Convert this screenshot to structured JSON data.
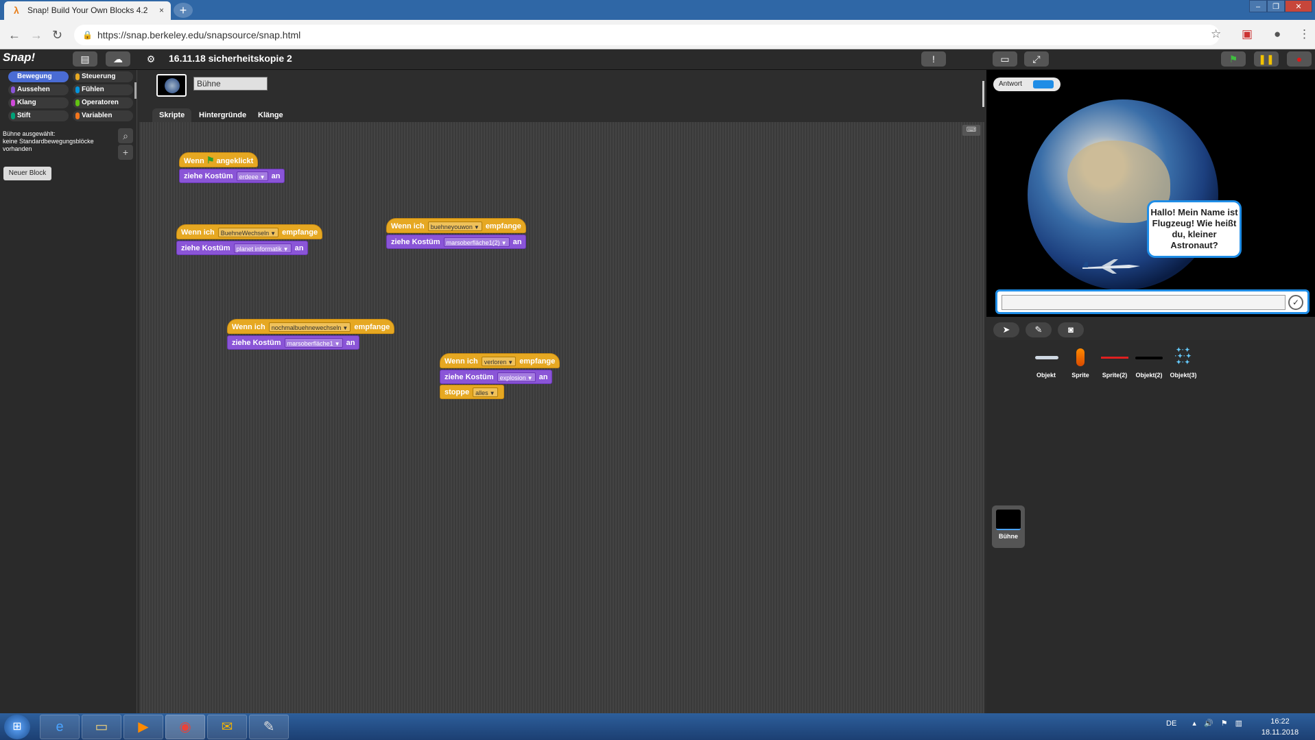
{
  "browser": {
    "tab_title": "Snap! Build Your Own Blocks 4.2",
    "tab_close": "×",
    "new_tab": "+",
    "url": "https://snap.berkeley.edu/snapsource/snap.html",
    "window_buttons": [
      "–",
      "❐",
      "✕"
    ]
  },
  "snap": {
    "logo": "Snap!",
    "project_title": "16.11.18 sicherheitskopie 2",
    "categories": [
      {
        "label": "Bewegung",
        "color": "#4a6cd4",
        "selected": true
      },
      {
        "label": "Steuerung",
        "color": "#e6a822"
      },
      {
        "label": "Aussehen",
        "color": "#8a55d7"
      },
      {
        "label": "Fühlen",
        "color": "#0494dc"
      },
      {
        "label": "Klang",
        "color": "#cf4ad9"
      },
      {
        "label": "Operatoren",
        "color": "#62c213"
      },
      {
        "label": "Stift",
        "color": "#00a178"
      },
      {
        "label": "Variablen",
        "color": "#f3761d"
      }
    ],
    "palette_message_1": "Bühne ausgewählt:",
    "palette_message_2": "keine Standardbewegungsblöcke",
    "palette_message_3": "vorhanden",
    "new_block_button": "Neuer Block",
    "sprite_name": "Bühne",
    "tabs": [
      "Skripte",
      "Hintergründe",
      "Klänge"
    ]
  },
  "scripts": {
    "s1": {
      "hat_pre": "Wenn",
      "hat_post": "angeklickt",
      "cmd_pre": "ziehe Kostüm",
      "cmd_slot": "erdeee",
      "cmd_post": "an"
    },
    "s2": {
      "hat_pre": "Wenn ich",
      "hat_slot": "BuehneWechseln",
      "hat_post": "empfange",
      "cmd_pre": "ziehe Kostüm",
      "cmd_slot": "planet informatik",
      "cmd_post": "an"
    },
    "s3": {
      "hat_pre": "Wenn ich",
      "hat_slot": "buehneyouwon",
      "hat_post": "empfange",
      "cmd_pre": "ziehe Kostüm",
      "cmd_slot": "marsoberfläche1(2)",
      "cmd_post": "an"
    },
    "s4": {
      "hat_pre": "Wenn ich",
      "hat_slot": "nochmalbuehnewechseln",
      "hat_post": "empfange",
      "cmd_pre": "ziehe Kostüm",
      "cmd_slot": "marsoberfläche1",
      "cmd_post": "an"
    },
    "s5": {
      "hat_pre": "Wenn ich",
      "hat_slot": "verloren",
      "hat_post": "empfange",
      "cmd_pre": "ziehe Kostüm",
      "cmd_slot": "explosion",
      "cmd_post": "an",
      "stop_pre": "stoppe",
      "stop_slot": "alles"
    }
  },
  "stage": {
    "watcher_label": "Antwort",
    "speech_bubble": "Hallo! Mein Name ist Flugzeug! Wie heißt du, kleiner Astronaut?",
    "ask_ok": "✓"
  },
  "corral": {
    "sprites": [
      "Objekt",
      "Sprite",
      "Sprite(2)",
      "Objekt(2)",
      "Objekt(3)"
    ],
    "stage_label": "Bühne"
  },
  "taskbar": {
    "language": "DE",
    "time": "16:22",
    "date": "18.11.2018"
  }
}
